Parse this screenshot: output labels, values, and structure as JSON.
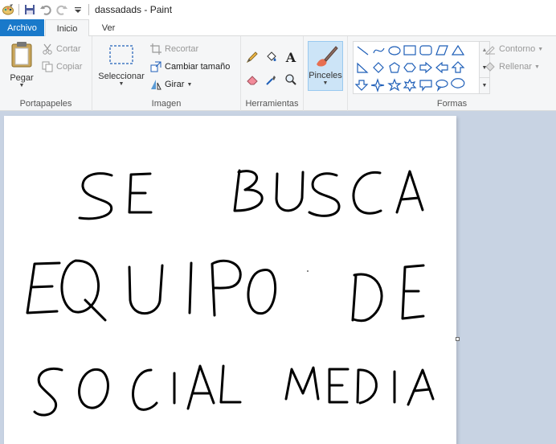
{
  "window": {
    "title": "dassadads - Paint"
  },
  "tabs": {
    "file": "Archivo",
    "home": "Inicio",
    "view": "Ver"
  },
  "clipboard": {
    "paste": "Pegar",
    "cut": "Cortar",
    "copy": "Copiar",
    "label": "Portapapeles"
  },
  "image": {
    "select": "Seleccionar",
    "crop": "Recortar",
    "resize": "Cambiar tamaño",
    "rotate": "Girar",
    "label": "Imagen"
  },
  "tools": {
    "label": "Herramientas"
  },
  "brushes": {
    "label": "Pinceles"
  },
  "shapes": {
    "outline": "Contorno",
    "fill": "Rellenar",
    "label": "Formas"
  },
  "canvas": {
    "lines": [
      "SE BUSCA",
      "EQUIPO DE",
      "SOCIAL MEDIA"
    ]
  },
  "colors": {
    "accent": "#1979ca",
    "ribbon": "#f5f6f7",
    "workspace": "#c8d3e3",
    "ink": "#000000"
  }
}
